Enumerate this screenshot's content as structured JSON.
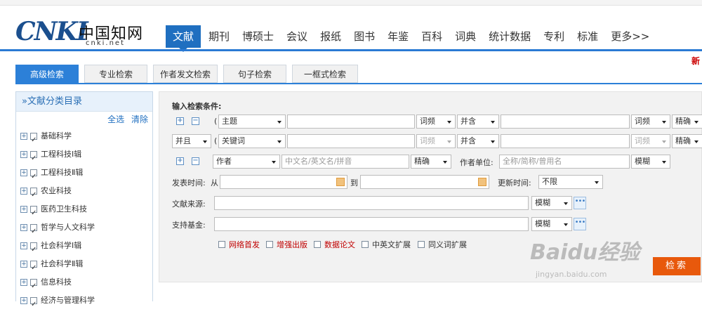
{
  "logo": {
    "text": "CNKI",
    "cn": "中国知网",
    "net": "cnki.net"
  },
  "nav": [
    "文献",
    "期刊",
    "博硕士",
    "会议",
    "报纸",
    "图书",
    "年鉴",
    "百科",
    "词典",
    "统计数据",
    "专利",
    "标准",
    "更多>>"
  ],
  "new_mark": "新",
  "tabs": [
    "高级检索",
    "专业检索",
    "作者发文检索",
    "句子检索",
    "一框式检索"
  ],
  "sidebar": {
    "title": "»文献分类目录",
    "select_all": "全选",
    "clear": "清除",
    "categories": [
      "基础科学",
      "工程科技Ⅰ辑",
      "工程科技Ⅱ辑",
      "农业科技",
      "医药卫生科技",
      "哲学与人文科学",
      "社会科学Ⅰ辑",
      "社会科学Ⅱ辑",
      "信息科技",
      "经济与管理科学"
    ]
  },
  "form": {
    "label": "输入检索条件:",
    "row1": {
      "paren": "(",
      "field": "主题",
      "freq": "词频",
      "op": "并含",
      "freq2": "词频",
      "match": "精确"
    },
    "row2": {
      "logic": "并且",
      "paren": "(",
      "field": "关键词",
      "freq": "词频",
      "op": "并含",
      "freq2": "词频",
      "match": "精确"
    },
    "row3": {
      "field": "作者",
      "author_placeholder": "中文名/英文名/拼音",
      "match": "精确",
      "unit_label": "作者单位:",
      "unit_placeholder": "全称/简称/曾用名",
      "unit_match": "模糊"
    },
    "date": {
      "label": "发表时间:",
      "from": "从",
      "to": "到",
      "update_label": "更新时间:",
      "update_value": "不限"
    },
    "source": {
      "label": "文献来源:",
      "match": "模糊"
    },
    "fund": {
      "label": "支持基金:",
      "match": "模糊"
    },
    "options": [
      "网络首发",
      "增强出版",
      "数据论文",
      "中英文扩展",
      "同义词扩展"
    ],
    "search_button": "检索"
  },
  "watermark": {
    "text": "Baidu经验",
    "url": "jingyan.baidu.com"
  },
  "colors": {
    "brand_blue": "#1f6fc0",
    "search_orange": "#e8590c",
    "option_red": "#c00000"
  }
}
